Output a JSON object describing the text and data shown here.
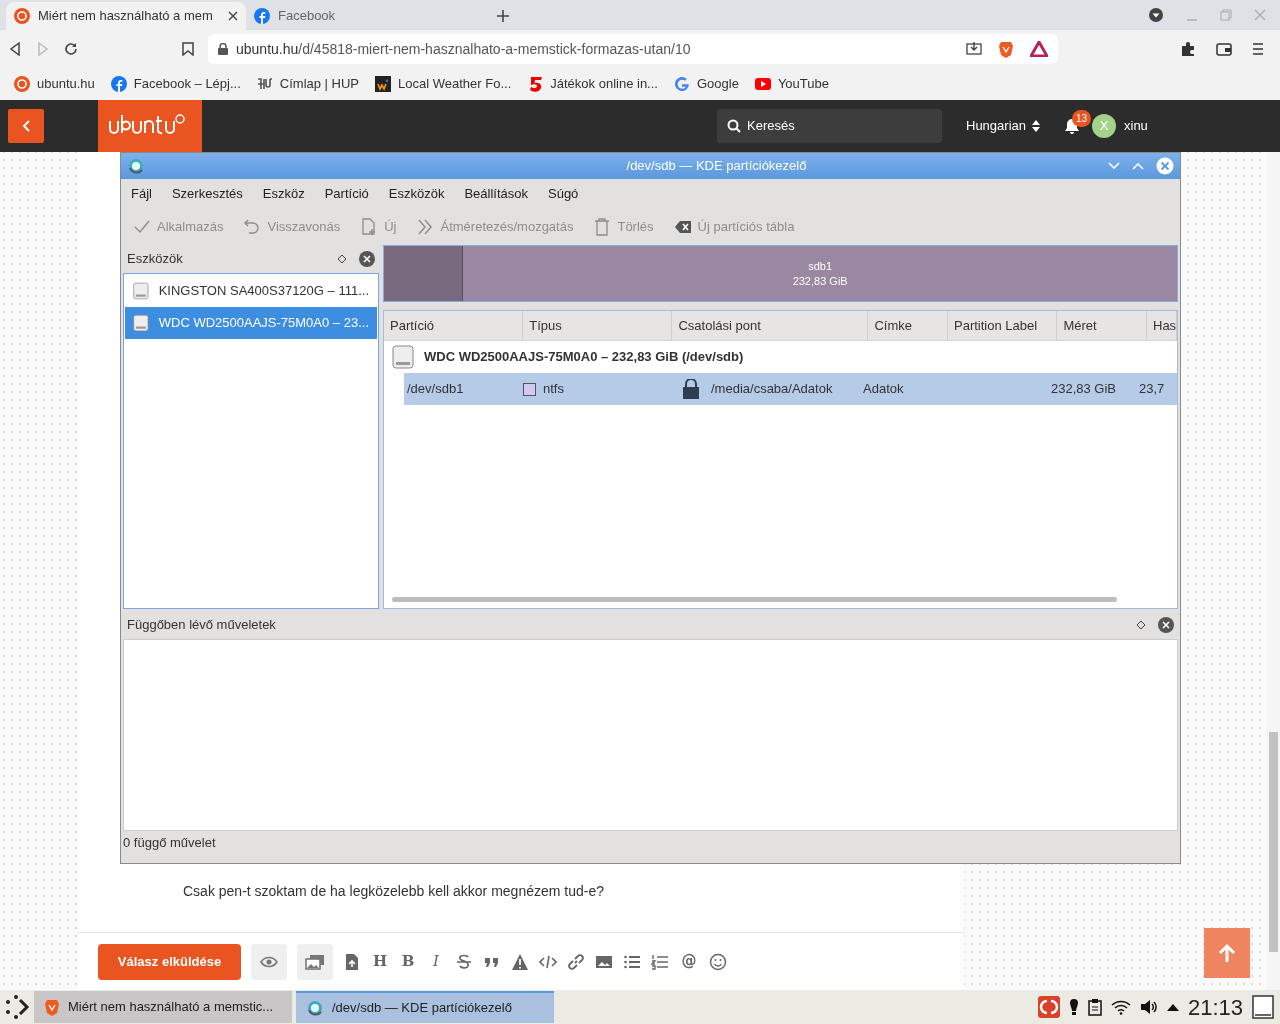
{
  "browser": {
    "tabs": [
      {
        "title": "Miért nem használható a mem",
        "selected": true
      },
      {
        "title": "Facebook",
        "selected": false
      }
    ],
    "url_host": "ubuntu.hu",
    "url_path": "/d/45818-miert-nem-hasznalhato-a-memstick-formazas-utan/10",
    "bookmarks": [
      "ubuntu.hu",
      "Facebook – Lépj...",
      "Címlap | HUP",
      "Local Weather Fo...",
      "Játékok online in...",
      "Google",
      "YouTube"
    ]
  },
  "site": {
    "search_placeholder": "Keresés",
    "language": "Hungarian",
    "notifications": "13",
    "avatar_letter": "X",
    "username": "xinu",
    "post_text": "Csak pen-t szoktam de ha legközelebb kell akkor megnézem tud-e?",
    "reply_button": "Válasz elküldése",
    "format_letters": [
      "H",
      "B",
      "I"
    ],
    "mention": "@"
  },
  "partition_manager": {
    "title": "/dev/sdb — KDE partíciókezelő",
    "menu": [
      "Fájl",
      "Szerkesztés",
      "Eszköz",
      "Partíció",
      "Eszközök",
      "Beállítások",
      "Súgó"
    ],
    "toolbar": [
      {
        "label": "Alkalmazás",
        "disabled": true
      },
      {
        "label": "Visszavonás",
        "disabled": true
      },
      {
        "label": "Új",
        "disabled": true
      },
      {
        "label": "Átméretezés/mozgatás",
        "disabled": true
      },
      {
        "label": "Törlés",
        "disabled": true
      },
      {
        "label": "Új partíciós tábla",
        "disabled": true
      }
    ],
    "devices_panel": {
      "title": "Eszközök",
      "devices": [
        {
          "name": "KINGSTON SA400S37120G – 111...",
          "selected": false
        },
        {
          "name": "WDC WD2500AAJS-75M0A0 – 23...",
          "selected": true
        }
      ]
    },
    "partition_bar": {
      "label": "sdb1",
      "size": "232,83 GiB",
      "level": 0.1
    },
    "table": {
      "columns": [
        "Partíció",
        "Típus",
        "Csatolási pont",
        "Címke",
        "Partition Label",
        "Méret",
        "Has"
      ],
      "device": "WDC WD2500AAJS-75M0A0 – 232,83 GiB (/dev/sdb)",
      "rows": [
        {
          "partition": "/dev/sdb1",
          "type": "ntfs",
          "color": "#d3c9f0",
          "mounted": true,
          "mount_point": "/media/csaba/Adatok",
          "label": "Adatok",
          "size": "232,83 GiB",
          "column_7": "23,7",
          "selected": true
        }
      ]
    },
    "pending": {
      "title": "Függőben lévő műveletek",
      "status": "0 függő művelet"
    }
  },
  "taskbar": {
    "tasks": [
      {
        "title": "Miért nem használható a memstic...",
        "selected": false
      },
      {
        "title": "/dev/sdb — KDE partíciókezelő",
        "selected": true
      }
    ],
    "clock": "21:13"
  }
}
